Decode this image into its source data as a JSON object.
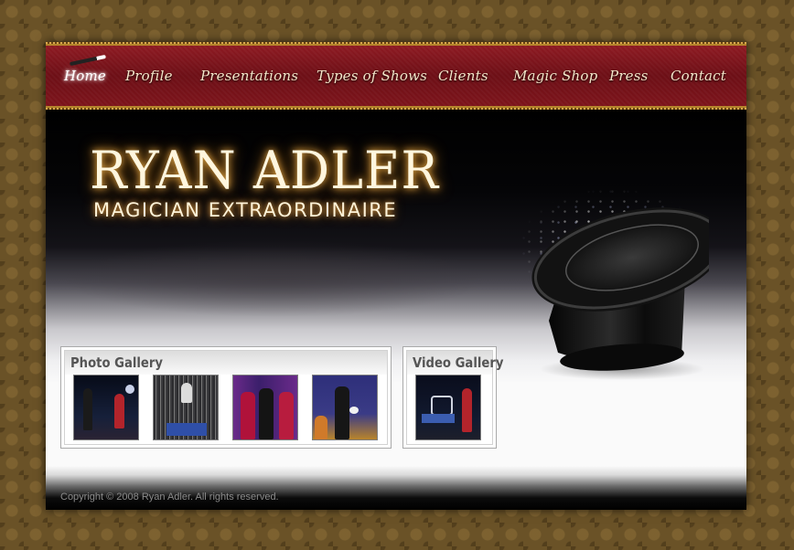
{
  "nav": {
    "items": [
      {
        "label": "Home",
        "active": true
      },
      {
        "label": "Profile"
      },
      {
        "label": "Presentations"
      },
      {
        "label": "Types of Shows"
      },
      {
        "label": "Clients"
      },
      {
        "label": "Magic Shop"
      },
      {
        "label": "Press"
      },
      {
        "label": "Contact"
      }
    ]
  },
  "hero": {
    "title": "RYAN ADLER",
    "subtitle": "MAGICIAN EXTRAORDINAIRE"
  },
  "photo_gallery": {
    "title": "Photo Gallery",
    "thumbnails": [
      "photo-1",
      "photo-2",
      "photo-3",
      "photo-4"
    ]
  },
  "video_gallery": {
    "title": "Video Gallery",
    "thumbnails": [
      "video-1"
    ]
  },
  "footer": {
    "copyright": "Copyright © 2008 Ryan Adler. All rights reserved."
  },
  "colors": {
    "nav_bg": "#7d141b",
    "gold_trim": "#b5852c",
    "page_bg": "#6a5227",
    "title_glow": "#f0b14a"
  }
}
